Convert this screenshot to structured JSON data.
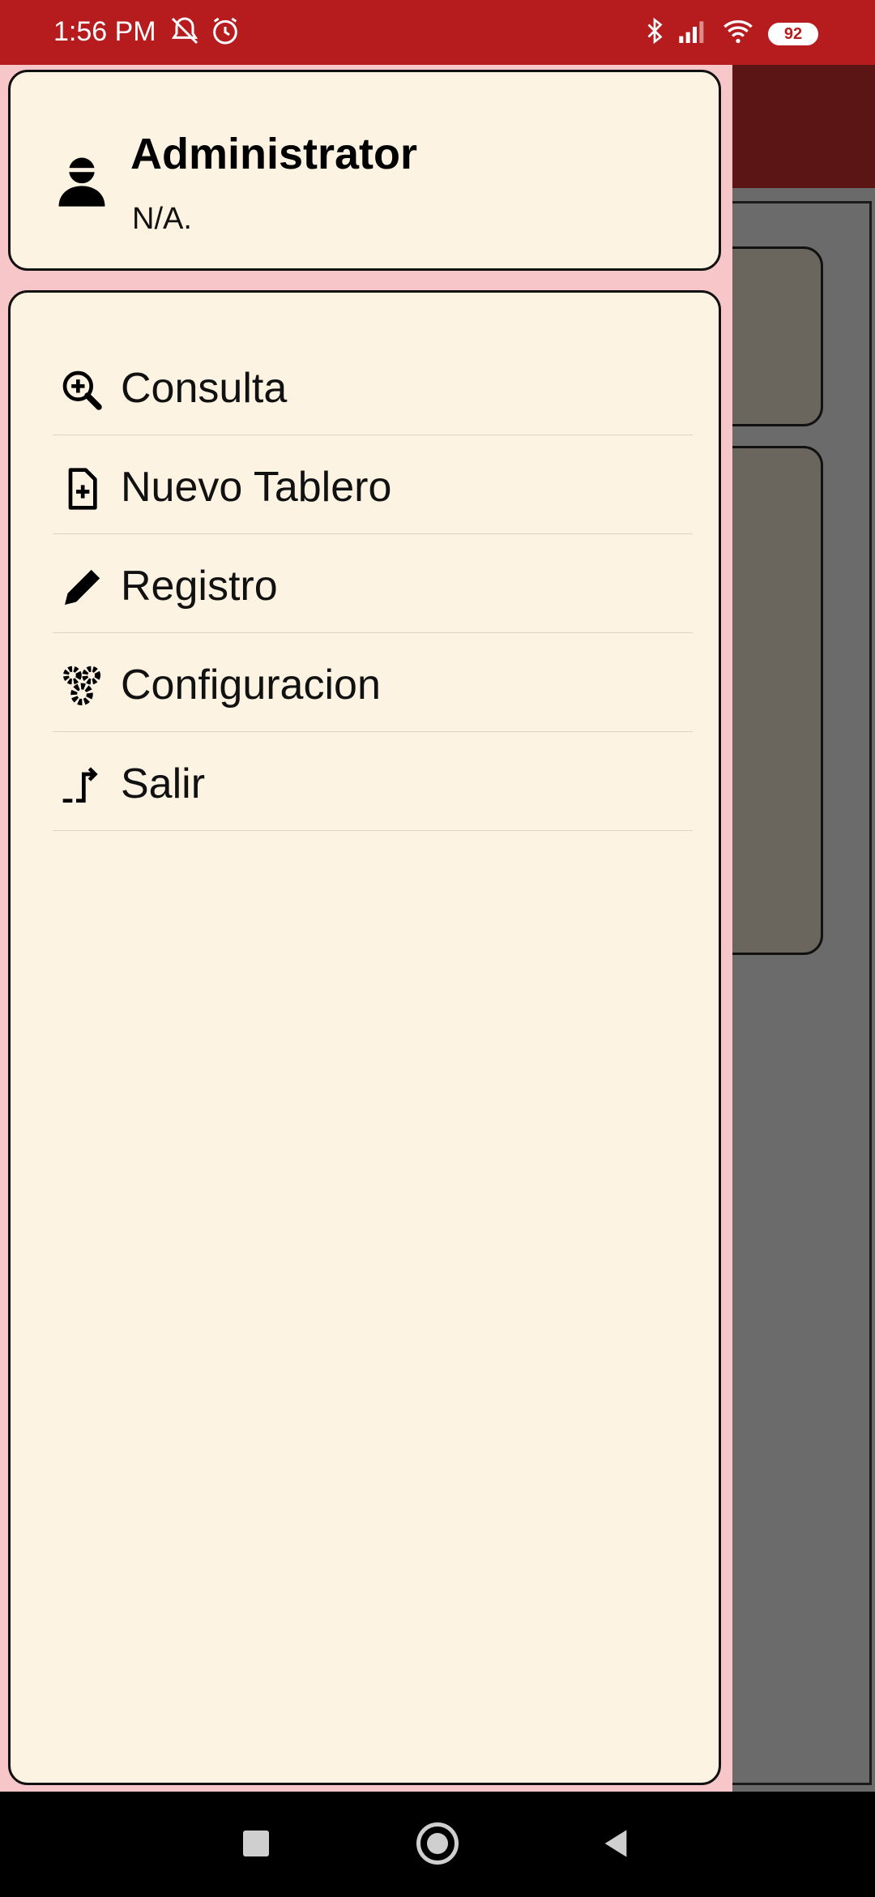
{
  "status_bar": {
    "time": "1:56 PM",
    "battery": "92",
    "icons": [
      "mute-bell-icon",
      "alarm-icon",
      "bluetooth-icon",
      "signal-icon",
      "wifi-icon",
      "battery-icon"
    ]
  },
  "drawer": {
    "user": {
      "name": "Administrator",
      "subtitle": "N/A.",
      "icon": "user-icon"
    },
    "menu": [
      {
        "label": "Consulta",
        "icon": "zoom-in-icon"
      },
      {
        "label": "Nuevo Tablero",
        "icon": "file-add-icon"
      },
      {
        "label": "Registro",
        "icon": "pencil-icon"
      },
      {
        "label": "Configuracion",
        "icon": "gears-icon"
      },
      {
        "label": "Salir",
        "icon": "exit-icon"
      }
    ]
  },
  "nav_bar": {
    "buttons": [
      "recents-button",
      "home-button",
      "back-button"
    ]
  },
  "colors": {
    "status_bar": "#b61c1e",
    "drawer_bg": "#f6c6c8",
    "card_bg": "#fcf3e3",
    "scrim": "#6a6a6a"
  }
}
